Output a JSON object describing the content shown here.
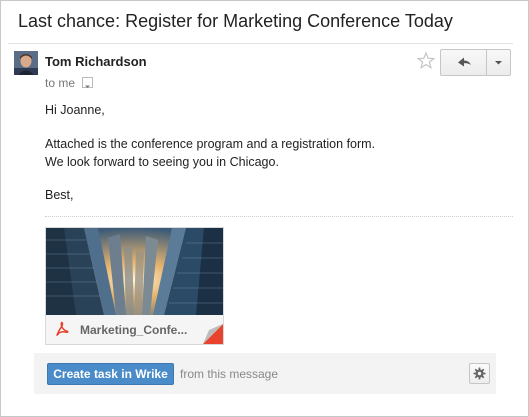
{
  "email": {
    "subject": "Last chance: Register for Marketing Conference Today",
    "sender_name": "Tom Richardson",
    "recipient_line": "to me",
    "greeting": "Hi Joanne,",
    "body_line_1": "Attached is the conference program and a registration form.",
    "body_line_2": "We look forward to seeing you in Chicago.",
    "signoff": "Best,"
  },
  "attachment": {
    "file_name": "Marketing_Confe...",
    "icon": "pdf-icon",
    "thumbnail": "city-skyscrapers-image"
  },
  "actions": {
    "reply_icon": "reply-icon",
    "more_icon": "chevron-down-icon",
    "star_icon": "star-icon"
  },
  "wrike": {
    "button_label": "Create task in Wrike",
    "from_text": "from this message",
    "settings_icon": "gear-icon"
  },
  "colors": {
    "wrike_button": "#4a8bc9",
    "pdf_red": "#e8432f",
    "bar_background": "#f3f3f3"
  }
}
